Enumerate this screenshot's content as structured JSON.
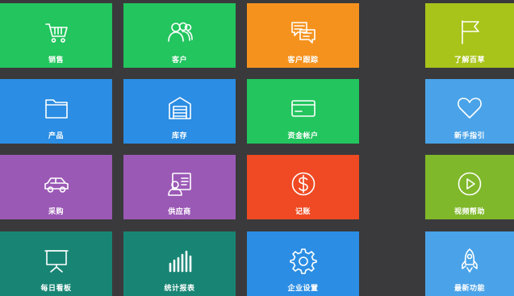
{
  "tiles": {
    "sales": {
      "label": "销售",
      "color": "#22c55e",
      "icon": "shopping-cart-icon"
    },
    "customers": {
      "label": "客户",
      "color": "#22c55e",
      "icon": "people-icon"
    },
    "followup": {
      "label": "客户跟踪",
      "color": "#f5921e",
      "icon": "chat-bubbles-icon"
    },
    "about": {
      "label": "了解百草",
      "color": "#a8c41a",
      "icon": "flag-icon"
    },
    "products": {
      "label": "产品",
      "color": "#2b8de3",
      "icon": "folder-icon"
    },
    "inventory": {
      "label": "库存",
      "color": "#2b8de3",
      "icon": "warehouse-icon"
    },
    "accounts": {
      "label": "资金帐户",
      "color": "#22c55e",
      "icon": "credit-card-icon"
    },
    "guide": {
      "label": "新手指引",
      "color": "#4aa3e8",
      "icon": "heart-icon"
    },
    "purchase": {
      "label": "采购",
      "color": "#9b59b6",
      "icon": "car-icon"
    },
    "suppliers": {
      "label": "供应商",
      "color": "#9b59b6",
      "icon": "contact-card-icon"
    },
    "bookkeeping": {
      "label": "记账",
      "color": "#ef4a23",
      "icon": "dollar-coin-icon"
    },
    "videohelp": {
      "label": "视频帮助",
      "color": "#7fb82a",
      "icon": "play-circle-icon"
    },
    "dashboard": {
      "label": "每日看板",
      "color": "#188574",
      "icon": "presentation-board-icon"
    },
    "reports": {
      "label": "统计报表",
      "color": "#188574",
      "icon": "bar-chart-icon"
    },
    "settings": {
      "label": "企业设置",
      "color": "#2b8de3",
      "icon": "gear-icon"
    },
    "features": {
      "label": "最新功能",
      "color": "#4aa3e8",
      "icon": "rocket-icon"
    }
  }
}
